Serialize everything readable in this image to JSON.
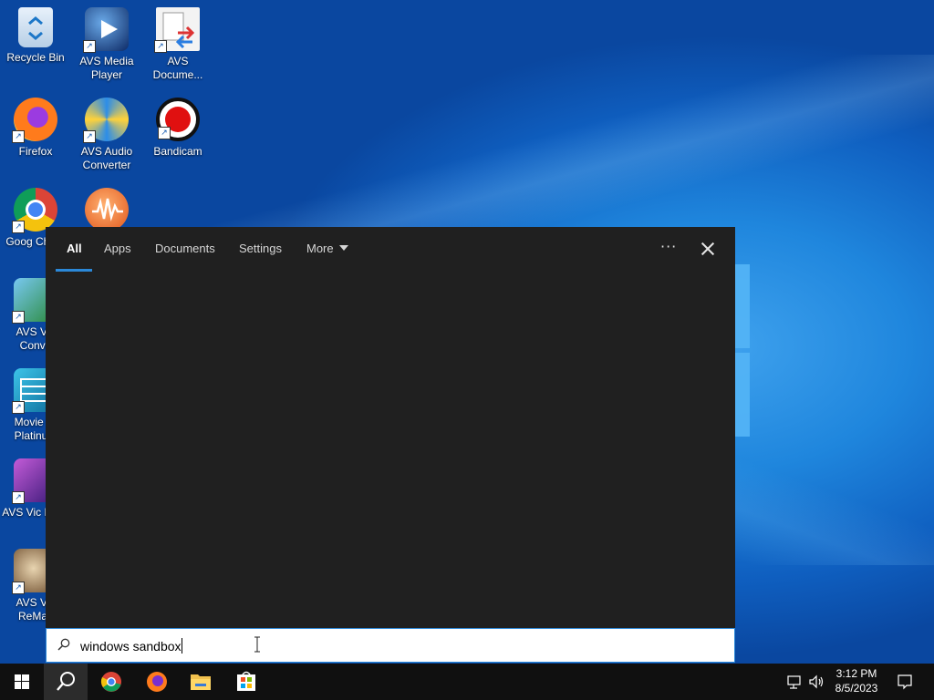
{
  "desktop": {
    "icons": [
      {
        "label": "Recycle Bin",
        "icon": "recycle-bin-icon"
      },
      {
        "label": "AVS Media Player",
        "icon": "avs-media-player-icon"
      },
      {
        "label": "AVS Docume...",
        "icon": "avs-document-converter-icon"
      },
      {
        "label": "Firefox",
        "icon": "firefox-icon"
      },
      {
        "label": "AVS Audio Converter",
        "icon": "avs-audio-converter-icon"
      },
      {
        "label": "Bandicam",
        "icon": "bandicam-icon"
      },
      {
        "label": "Goog Chron",
        "icon": "google-chrome-icon"
      },
      {
        "label": "",
        "icon": "avs-audio-editor-icon"
      },
      {
        "label": "AVS Vic Conve",
        "icon": "avs-video-converter-icon"
      },
      {
        "label": "Movie St Platinum",
        "icon": "movie-studio-platinum-icon"
      },
      {
        "label": "AVS Vic Edito",
        "icon": "avs-video-editor-icon"
      },
      {
        "label": "AVS Vic ReMak",
        "icon": "avs-video-remaker-icon"
      }
    ]
  },
  "search": {
    "tabs": [
      {
        "label": "All",
        "active": true
      },
      {
        "label": "Apps",
        "active": false
      },
      {
        "label": "Documents",
        "active": false
      },
      {
        "label": "Settings",
        "active": false
      },
      {
        "label": "More",
        "active": false
      }
    ],
    "options_icon": "ellipsis-icon",
    "close_icon": "close-icon",
    "query": "windows sandbox",
    "accent_color": "#2b88d8",
    "panel_color": "#202020"
  },
  "taskbar": {
    "items": [
      {
        "name": "start-button",
        "icon": "windows-logo-icon"
      },
      {
        "name": "search-button",
        "icon": "search-icon",
        "active": true
      },
      {
        "name": "chrome-taskbar",
        "icon": "google-chrome-icon"
      },
      {
        "name": "firefox-taskbar",
        "icon": "firefox-icon"
      },
      {
        "name": "file-explorer-taskbar",
        "icon": "folder-icon"
      },
      {
        "name": "microsoft-store-taskbar",
        "icon": "store-icon"
      }
    ],
    "tray": {
      "time": "3:12 PM",
      "date": "8/5/2023",
      "icons": [
        "network-icon",
        "volume-icon",
        "notification-icon"
      ]
    }
  }
}
